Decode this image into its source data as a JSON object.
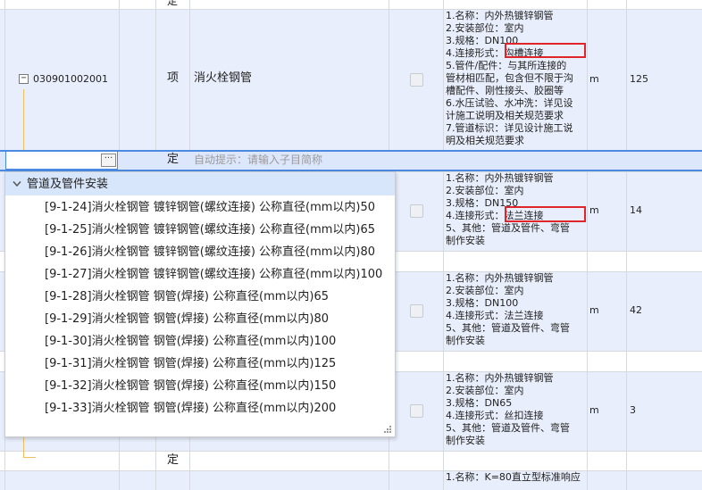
{
  "rows": {
    "top": {
      "unit_type": "定"
    },
    "item1": {
      "code": "030901002001",
      "type": "项",
      "name": "消火栓钢管",
      "desc": [
        "1.名称：内外热镀锌钢管",
        "2.安装部位：室内",
        "3.规格：DN100",
        "4.连接形式：沟槽连接",
        "5.管件/配件：与其所连接的",
        "管材相匹配，包含但不限于沟",
        "槽配件、刚性接头、胶圈等",
        "6.水压试验、水冲洗：详见设",
        "计施工说明及相关规范要求",
        "7.管道标识：详见设计施工说",
        "明及相关规范要求"
      ],
      "unit": "m",
      "qty": "125"
    },
    "edit": {
      "type": "定",
      "hint": "自动提示：请输入子目简称"
    },
    "item2": {
      "desc": [
        "1.名称：内外热镀锌钢管",
        "2.安装部位：室内",
        "3.规格：DN150",
        "4.连接形式：法兰连接",
        "5、其他：管道及管件、弯管",
        "制作安装"
      ],
      "unit": "m",
      "qty": "14"
    },
    "item3": {
      "desc": [
        "1.名称：内外热镀锌钢管",
        "2.安装部位：室内",
        "3.规格：DN100",
        "4.连接形式：法兰连接",
        "5、其他：管道及管件、弯管",
        "制作安装"
      ],
      "unit": "m",
      "qty": "42"
    },
    "item4": {
      "desc": [
        "1.名称：内外热镀锌钢管",
        "2.安装部位：室内",
        "3.规格：DN65",
        "4.连接形式：丝扣连接",
        "5、其他：管道及管件、弯管",
        "制作安装"
      ],
      "unit": "m",
      "qty": "3"
    },
    "bottom": {
      "type": "定",
      "desc_partial": "1.名称：K=80直立型标准响应"
    }
  },
  "popup": {
    "group_label": "管道及管件安装",
    "items": [
      "[9-1-24]消火栓钢管 镀锌钢管(螺纹连接) 公称直径(mm以内)50",
      "[9-1-25]消火栓钢管 镀锌钢管(螺纹连接) 公称直径(mm以内)65",
      "[9-1-26]消火栓钢管 镀锌钢管(螺纹连接) 公称直径(mm以内)80",
      "[9-1-27]消火栓钢管 镀锌钢管(螺纹连接) 公称直径(mm以内)100",
      "[9-1-28]消火栓钢管 钢管(焊接) 公称直径(mm以内)65",
      "[9-1-29]消火栓钢管 钢管(焊接) 公称直径(mm以内)80",
      "[9-1-30]消火栓钢管 钢管(焊接) 公称直径(mm以内)100",
      "[9-1-31]消火栓钢管 钢管(焊接) 公称直径(mm以内)125",
      "[9-1-32]消火栓钢管 钢管(焊接) 公称直径(mm以内)150",
      "[9-1-33]消火栓钢管 钢管(焊接) 公称直径(mm以内)200"
    ]
  },
  "colors": {
    "row_blue": "#e8eefb",
    "highlight_red": "#e0242a",
    "selection_blue": "#4a8ae0",
    "popup_header": "#d7e6fb"
  },
  "icons": {
    "expand": "minus-box-icon",
    "more": "ellipsis-icon",
    "collapse": "chevron-down-icon",
    "resize": "resize-grip-icon"
  }
}
